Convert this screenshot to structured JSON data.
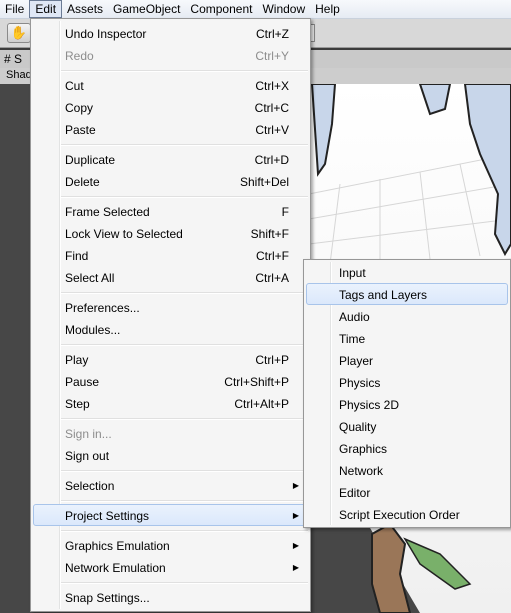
{
  "menubar": {
    "file": "File",
    "edit": "Edit",
    "assets": "Assets",
    "gameobject": "GameObject",
    "component": "Component",
    "window": "Window",
    "help": "Help"
  },
  "scene": {
    "tab_label": "# S",
    "mode_label": "Shad"
  },
  "edit_menu": {
    "undo": {
      "label": "Undo Inspector",
      "shortcut": "Ctrl+Z"
    },
    "redo": {
      "label": "Redo",
      "shortcut": "Ctrl+Y"
    },
    "cut": {
      "label": "Cut",
      "shortcut": "Ctrl+X"
    },
    "copy": {
      "label": "Copy",
      "shortcut": "Ctrl+C"
    },
    "paste": {
      "label": "Paste",
      "shortcut": "Ctrl+V"
    },
    "duplicate": {
      "label": "Duplicate",
      "shortcut": "Ctrl+D"
    },
    "delete": {
      "label": "Delete",
      "shortcut": "Shift+Del"
    },
    "frame_selected": {
      "label": "Frame Selected",
      "shortcut": "F"
    },
    "lock_view": {
      "label": "Lock View to Selected",
      "shortcut": "Shift+F"
    },
    "find": {
      "label": "Find",
      "shortcut": "Ctrl+F"
    },
    "select_all": {
      "label": "Select All",
      "shortcut": "Ctrl+A"
    },
    "preferences": {
      "label": "Preferences..."
    },
    "modules": {
      "label": "Modules..."
    },
    "play": {
      "label": "Play",
      "shortcut": "Ctrl+P"
    },
    "pause": {
      "label": "Pause",
      "shortcut": "Ctrl+Shift+P"
    },
    "step": {
      "label": "Step",
      "shortcut": "Ctrl+Alt+P"
    },
    "sign_in": {
      "label": "Sign in..."
    },
    "sign_out": {
      "label": "Sign out"
    },
    "selection": {
      "label": "Selection"
    },
    "project_settings": {
      "label": "Project Settings"
    },
    "graphics_emulation": {
      "label": "Graphics Emulation"
    },
    "network_emulation": {
      "label": "Network Emulation"
    },
    "snap_settings": {
      "label": "Snap Settings..."
    }
  },
  "project_settings_submenu": [
    "Input",
    "Tags and Layers",
    "Audio",
    "Time",
    "Player",
    "Physics",
    "Physics 2D",
    "Quality",
    "Graphics",
    "Network",
    "Editor",
    "Script Execution Order"
  ],
  "icons": {
    "hand_tool": "hand-icon",
    "submenu_arrow": "submenu-arrow-icon"
  }
}
